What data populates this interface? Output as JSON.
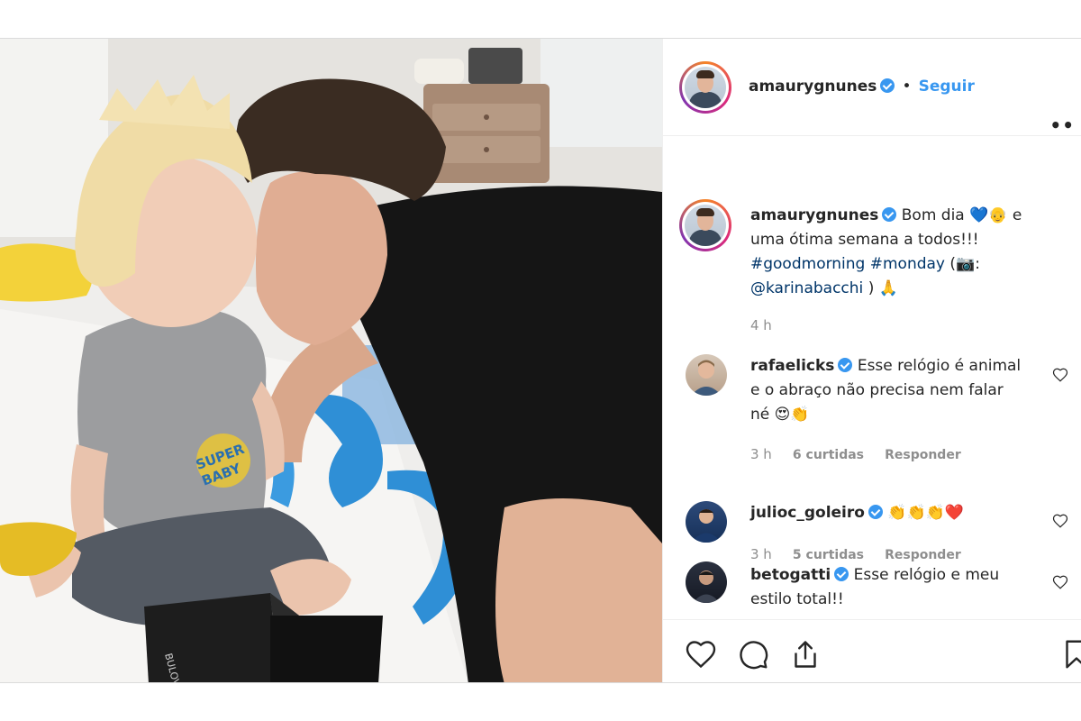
{
  "post": {
    "author": {
      "username": "amaurygnunes",
      "follow_separator": "•",
      "follow_label": "Seguir",
      "more_label": "••"
    },
    "caption": {
      "username": "amaurygnunes",
      "text_line1": "Bom dia 💙👴 e",
      "text_line2": "uma ótima semana a todos!!!",
      "hashtags": "#goodmorning #monday",
      "photo_credit_open": "(📷:",
      "mention": "@karinabacchi",
      "photo_credit_close": ") 🙏",
      "time": "4 h"
    },
    "comments": [
      {
        "username": "rafaelicks",
        "line1": "Esse relógio é animal",
        "line2": "e o abraço não precisa nem falar",
        "line3": "né 😍👏",
        "time": "3 h",
        "likes": "6 curtidas",
        "reply_label": "Responder"
      },
      {
        "username": "julioc_goleiro",
        "line1": "👏👏👏❤️",
        "time": "3 h",
        "likes": "5 curtidas",
        "reply_label": "Responder"
      },
      {
        "username": "betogatti",
        "line1": "Esse relógio e meu",
        "line2": "estilo total!!"
      }
    ],
    "photo": {
      "shirt_text_1": "SUPER",
      "shirt_text_2": "BABY",
      "box_text": "BULOVA"
    },
    "colors": {
      "link": "#3897f0",
      "hashtag": "#003569",
      "muted": "#8e8e8e",
      "verified": "#3897f0"
    }
  }
}
